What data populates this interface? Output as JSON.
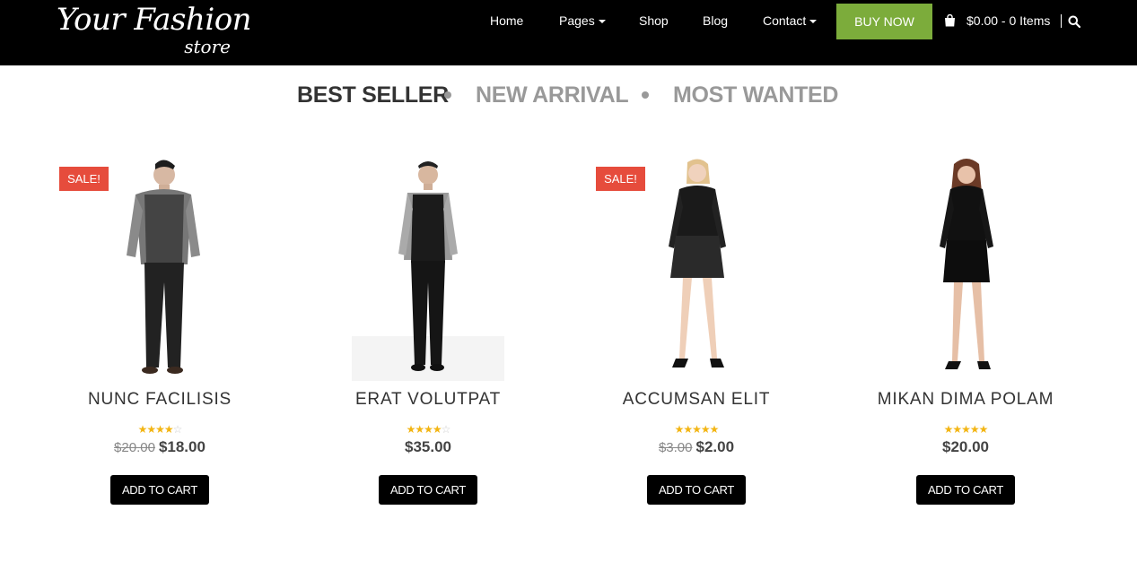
{
  "header": {
    "logo_main": "Your Fashion",
    "logo_sub": "store",
    "nav": [
      {
        "label": "Home"
      },
      {
        "label": "Pages"
      },
      {
        "label": "Shop"
      },
      {
        "label": "Blog"
      },
      {
        "label": "Contact"
      }
    ],
    "buy_now": "BUY NOW",
    "cart_label": "$0.00 - 0 Items",
    "icons": {
      "cart": "shopping-bag-icon",
      "search": "search-icon"
    },
    "accent_color": "#7cac3b"
  },
  "tabs": [
    {
      "label": "BEST SELLER",
      "active": true
    },
    {
      "label": "NEW ARRIVAL",
      "active": false
    },
    {
      "label": "MOST WANTED",
      "active": false
    }
  ],
  "products": [
    {
      "name": "NUNC FACILISIS",
      "sale_badge": "SALE!",
      "old_price": "$20.00",
      "price": "$18.00",
      "rating": 4,
      "add_to_cart": "ADD TO CART"
    },
    {
      "name": "ERAT VOLUTPAT",
      "sale_badge": "",
      "old_price": "",
      "price": "$35.00",
      "rating": 4,
      "add_to_cart": "ADD TO CART"
    },
    {
      "name": "ACCUMSAN ELIT",
      "sale_badge": "SALE!",
      "old_price": "$3.00",
      "price": "$2.00",
      "rating": 4.5,
      "add_to_cart": "ADD TO CART"
    },
    {
      "name": "MIKAN DIMA POLAM",
      "sale_badge": "",
      "old_price": "",
      "price": "$20.00",
      "rating": 4.5,
      "add_to_cart": "ADD TO CART"
    }
  ],
  "colors": {
    "sale_badge": "#e64c3c",
    "star": "#f3b513"
  }
}
